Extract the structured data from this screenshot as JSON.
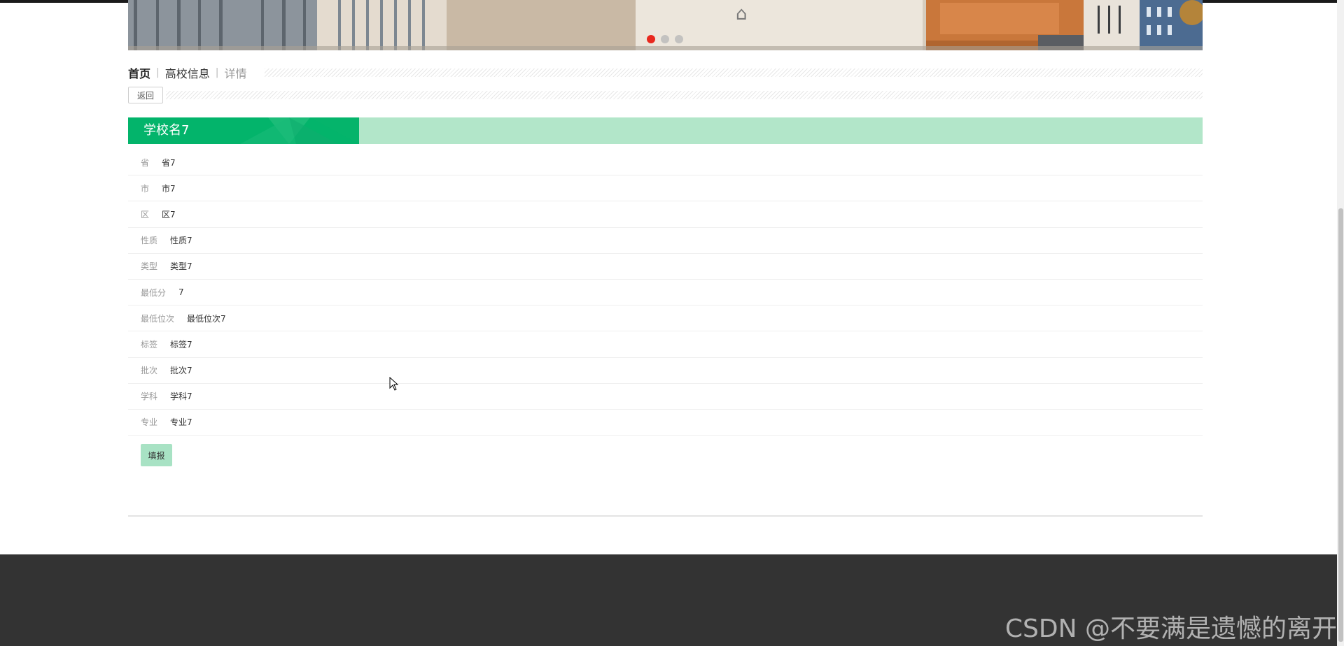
{
  "breadcrumb": {
    "home": "首页",
    "section": "高校信息",
    "current": "详情"
  },
  "actions": {
    "back_label": "返回",
    "submit_label": "填报"
  },
  "school": {
    "name": "学校名7"
  },
  "details": [
    {
      "label": "省",
      "value": "省7"
    },
    {
      "label": "市",
      "value": "市7"
    },
    {
      "label": "区",
      "value": "区7"
    },
    {
      "label": "性质",
      "value": "性质7"
    },
    {
      "label": "类型",
      "value": "类型7"
    },
    {
      "label": "最低分",
      "value": "7"
    },
    {
      "label": "最低位次",
      "value": "最低位次7"
    },
    {
      "label": "标签",
      "value": "标签7"
    },
    {
      "label": "批次",
      "value": "批次7"
    },
    {
      "label": "学科",
      "value": "学科7"
    },
    {
      "label": "专业",
      "value": "专业7"
    }
  ],
  "carousel": {
    "slide_count": 3,
    "active_index": 0
  },
  "footer": {
    "watermark": "CSDN @不要满是遗憾的离开"
  },
  "colors": {
    "accent_green": "#03b46b",
    "light_green": "#b2e6c9",
    "button_green": "#a8e2c4",
    "active_dot": "#e8281e",
    "footer_bg": "#333333"
  },
  "icons": {
    "cursor": "arrow-pointer-icon"
  }
}
